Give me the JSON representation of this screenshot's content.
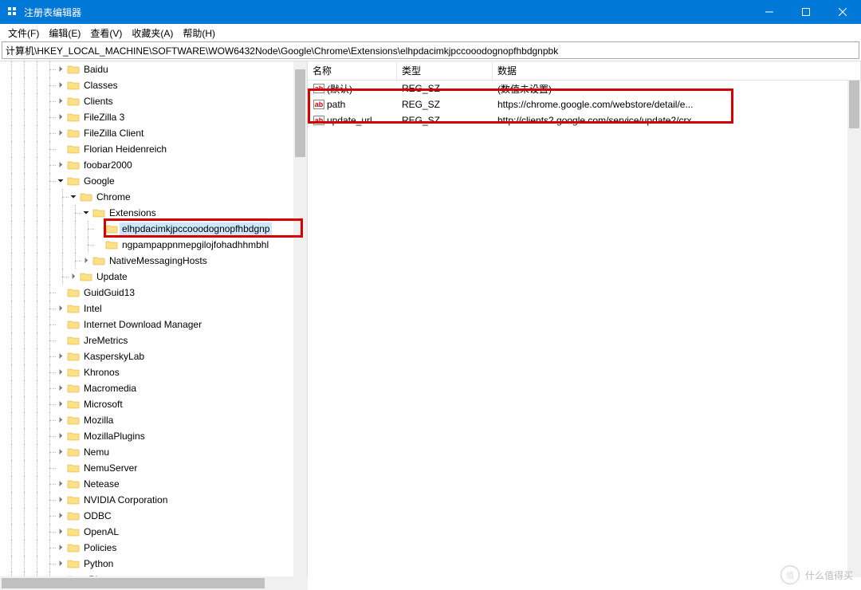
{
  "window": {
    "title": "注册表编辑器"
  },
  "menu": {
    "file": "文件(F)",
    "edit": "编辑(E)",
    "view": "查看(V)",
    "fav": "收藏夹(A)",
    "help": "帮助(H)"
  },
  "address": "计算机\\HKEY_LOCAL_MACHINE\\SOFTWARE\\WOW6432Node\\Google\\Chrome\\Extensions\\elhpdacimkjpccooodognopfhbdgnpbk",
  "tree": [
    {
      "indent": 4,
      "chev": ">",
      "label": "Baidu"
    },
    {
      "indent": 4,
      "chev": ">",
      "label": "Classes"
    },
    {
      "indent": 4,
      "chev": ">",
      "label": "Clients"
    },
    {
      "indent": 4,
      "chev": ">",
      "label": "FileZilla 3"
    },
    {
      "indent": 4,
      "chev": ">",
      "label": "FileZilla Client"
    },
    {
      "indent": 4,
      "chev": "",
      "label": "Florian Heidenreich"
    },
    {
      "indent": 4,
      "chev": ">",
      "label": "foobar2000"
    },
    {
      "indent": 4,
      "chev": "v",
      "label": "Google"
    },
    {
      "indent": 5,
      "chev": "v",
      "label": "Chrome"
    },
    {
      "indent": 6,
      "chev": "v",
      "label": "Extensions"
    },
    {
      "indent": 7,
      "chev": "",
      "label": "elhpdacimkjpccooodognopfhbdgnp",
      "selected": true,
      "redbox": true
    },
    {
      "indent": 7,
      "chev": "",
      "label": "ngpampappnmepgilojfohadhhmbhl"
    },
    {
      "indent": 6,
      "chev": ">",
      "label": "NativeMessagingHosts"
    },
    {
      "indent": 5,
      "chev": ">",
      "label": "Update"
    },
    {
      "indent": 4,
      "chev": "",
      "label": "GuidGuid13"
    },
    {
      "indent": 4,
      "chev": ">",
      "label": "Intel"
    },
    {
      "indent": 4,
      "chev": "",
      "label": "Internet Download Manager"
    },
    {
      "indent": 4,
      "chev": "",
      "label": "JreMetrics"
    },
    {
      "indent": 4,
      "chev": ">",
      "label": "KasperskyLab"
    },
    {
      "indent": 4,
      "chev": ">",
      "label": "Khronos"
    },
    {
      "indent": 4,
      "chev": ">",
      "label": "Macromedia"
    },
    {
      "indent": 4,
      "chev": ">",
      "label": "Microsoft"
    },
    {
      "indent": 4,
      "chev": ">",
      "label": "Mozilla"
    },
    {
      "indent": 4,
      "chev": ">",
      "label": "MozillaPlugins"
    },
    {
      "indent": 4,
      "chev": ">",
      "label": "Nemu"
    },
    {
      "indent": 4,
      "chev": "",
      "label": "NemuServer"
    },
    {
      "indent": 4,
      "chev": ">",
      "label": "Netease"
    },
    {
      "indent": 4,
      "chev": ">",
      "label": "NVIDIA Corporation"
    },
    {
      "indent": 4,
      "chev": ">",
      "label": "ODBC"
    },
    {
      "indent": 4,
      "chev": ">",
      "label": "OpenAL"
    },
    {
      "indent": 4,
      "chev": ">",
      "label": "Policies"
    },
    {
      "indent": 4,
      "chev": ">",
      "label": "Python"
    },
    {
      "indent": 4,
      "chev": ">",
      "label": "qBittorrent"
    }
  ],
  "columns": {
    "name": "名称",
    "type": "类型",
    "data": "数据"
  },
  "values": [
    {
      "name": "(默认)",
      "type": "REG_SZ",
      "data": "(数值未设置)"
    },
    {
      "name": "path",
      "type": "REG_SZ",
      "data": "https://chrome.google.com/webstore/detail/e..."
    },
    {
      "name": "update_url",
      "type": "REG_SZ",
      "data": "http://clients2.google.com/service/update2/crx"
    }
  ],
  "watermark": "什么值得买"
}
